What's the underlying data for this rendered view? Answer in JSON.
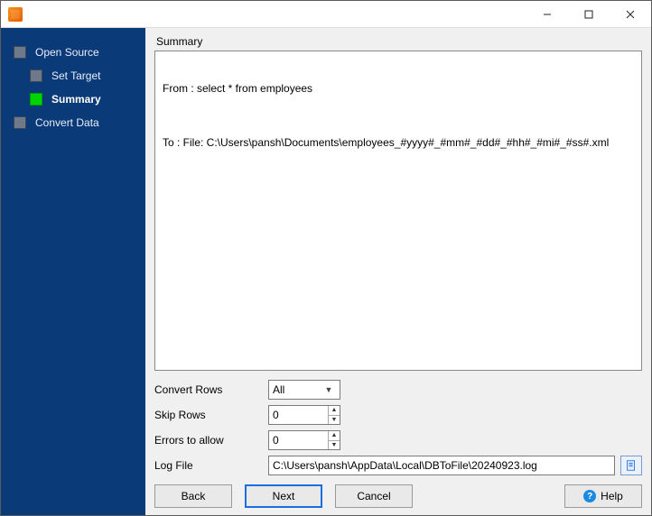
{
  "window": {
    "title": ""
  },
  "sidebar": {
    "items": [
      {
        "label": "Open Source",
        "current": false,
        "child": false
      },
      {
        "label": "Set Target",
        "current": false,
        "child": true
      },
      {
        "label": "Summary",
        "current": true,
        "child": true
      },
      {
        "label": "Convert Data",
        "current": false,
        "child": false
      }
    ]
  },
  "summary": {
    "heading": "Summary",
    "from_line": "From : select * from employees",
    "to_line": "To : File: C:\\Users\\pansh\\Documents\\employees_#yyyy#_#mm#_#dd#_#hh#_#mi#_#ss#.xml"
  },
  "form": {
    "convert_rows_label": "Convert Rows",
    "convert_rows_value": "All",
    "skip_rows_label": "Skip Rows",
    "skip_rows_value": "0",
    "errors_label": "Errors to allow",
    "errors_value": "0",
    "logfile_label": "Log File",
    "logfile_value": "C:\\Users\\pansh\\AppData\\Local\\DBToFile\\20240923.log"
  },
  "buttons": {
    "back": "Back",
    "next": "Next",
    "cancel": "Cancel",
    "help": "Help"
  }
}
